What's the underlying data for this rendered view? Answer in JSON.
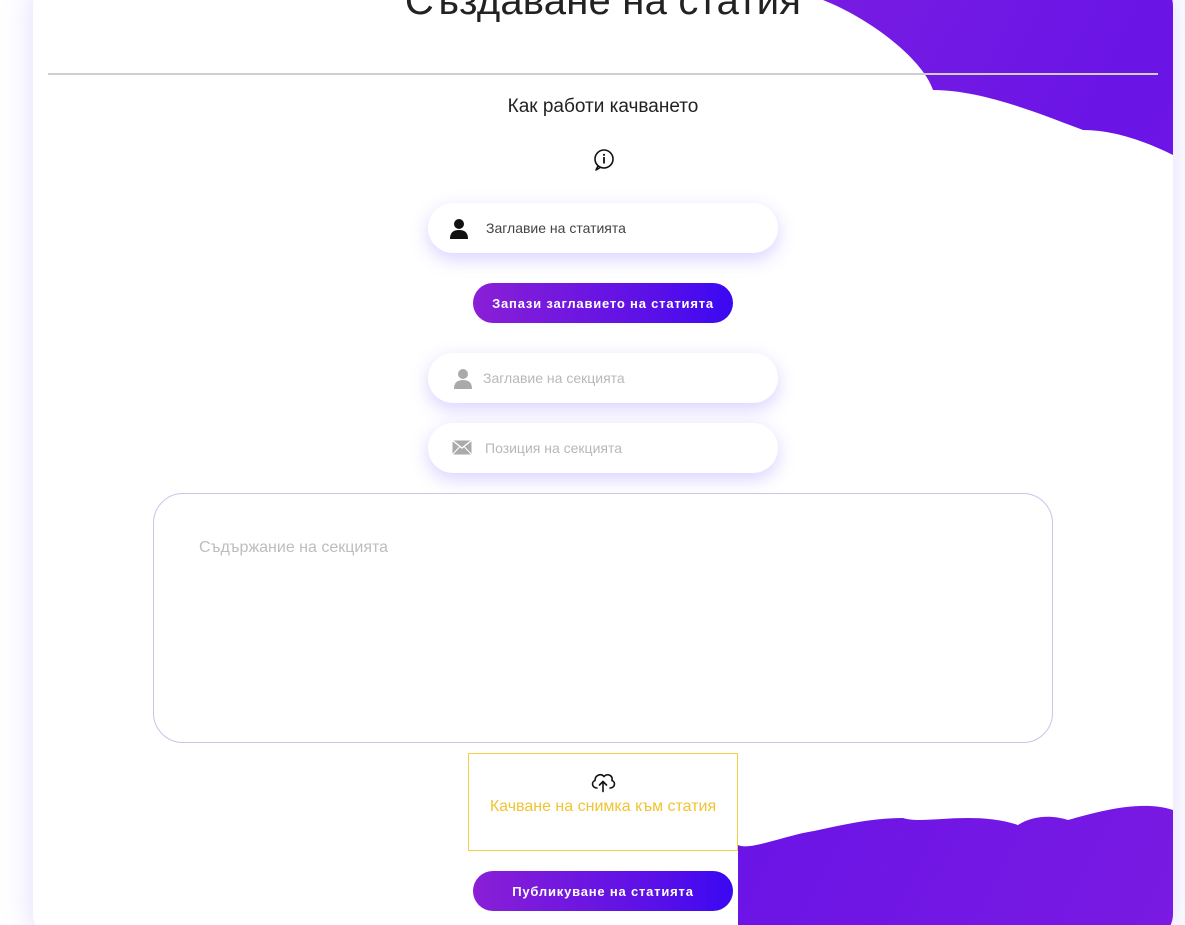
{
  "page": {
    "title": "Създаване на статия",
    "subtitle": "Как работи качването"
  },
  "form": {
    "article_title_placeholder": "Заглавие на статията",
    "save_title_button": "Запази заглавието на статията",
    "section_title_placeholder": "Заглавие на секцията",
    "section_position_placeholder": "Позиция на секцията",
    "section_content_placeholder": "Съдържание на секцията",
    "upload_label": "Качване на снимка към статия",
    "publish_button": "Публикуване на статията"
  },
  "icons": {
    "info": "info-icon",
    "article_title": "user-icon",
    "section_title": "user-icon",
    "section_position": "envelope-icon",
    "upload": "cloud-upload-icon"
  },
  "colors": {
    "accent_purple": "#8a1fd6",
    "accent_blue": "#3a08f2",
    "upload_yellow": "#f0c432",
    "cloud_background": "#7a1be0"
  }
}
